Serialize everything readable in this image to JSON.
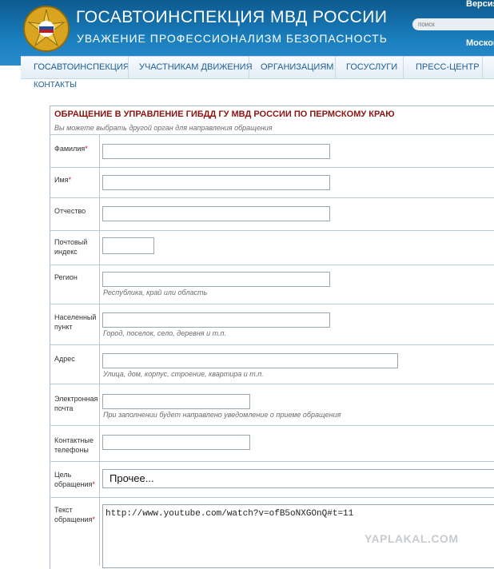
{
  "header": {
    "title": "ГОСАВТОИНСПЕКЦИЯ МВД РОССИИ",
    "slogan": "УВАЖЕНИЕ  ПРОФЕССИОНАЛИЗМ  БЕЗОПАСНОСТЬ",
    "version_label": "Версия д",
    "search_placeholder": "поиск",
    "city": "Москов",
    "logo_icon": "police-emblem-icon"
  },
  "nav": {
    "items": [
      "ГОСАВТОИНСПЕКЦИЯ",
      "УЧАСТНИКАМ ДВИЖЕНИЯ",
      "ОРГАНИЗАЦИЯМ",
      "ГОСУСЛУГИ",
      "ПРЕСС-ЦЕНТР"
    ],
    "contacts": "КОНТАКТЫ"
  },
  "form": {
    "title": "ОБРАЩЕНИЕ В УПРАВЛЕНИЕ ГИБДД ГУ МВД РОССИИ ПО ПЕРМСКОМУ КРАЮ",
    "subtitle": "Вы можете выбрать другой орган для направления обращения",
    "required_mark": "*",
    "fields": {
      "last_name": {
        "label": "Фамилия",
        "value": ""
      },
      "first_name": {
        "label": "Имя",
        "value": ""
      },
      "patronymic": {
        "label": "Отчество",
        "value": ""
      },
      "postal_line1": "Почтовый",
      "postal_line2": "индекс",
      "region": {
        "label": "Регион",
        "hint": "Республика, край или область"
      },
      "locality_line1": "Населенный",
      "locality_line2": "пункт",
      "locality_hint": "Город, поселок, село, деревня и т.п.",
      "address": {
        "label": "Адрес",
        "hint": "Улица, дом, корпус, строение, квартира и т.п."
      },
      "email_line1": "Электронная",
      "email_line2": "почта",
      "email_hint": "При заполнении будет направлено уведомление о приеме обращения",
      "phones_line1": "Контактные",
      "phones_line2": "телефоны",
      "purpose_line1": "Цель",
      "purpose_line2": "обращения",
      "purpose_value": "Прочее...",
      "text_line1": "Текст",
      "text_line2": "обращения",
      "text_value": "http://www.youtube.com/watch?v=ofB5oNXGOnQ#t=11"
    }
  },
  "watermark": "YAPLAKAL.COM",
  "colors": {
    "header_blue": "#1a7fbf",
    "title_red": "#8a1612",
    "nav_text": "#1d5f96"
  }
}
